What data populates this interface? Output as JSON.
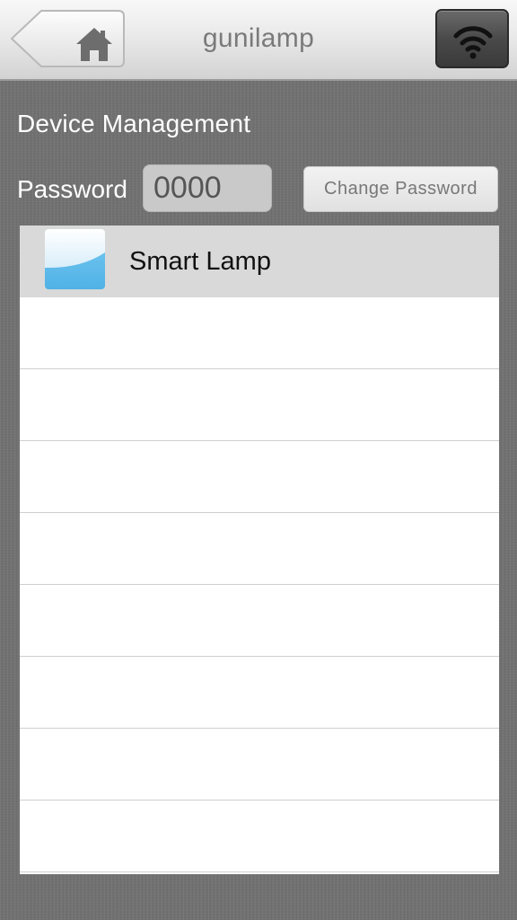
{
  "navbar": {
    "title": "gunilamp",
    "home_icon": "home-icon",
    "wifi_icon": "wifi-icon"
  },
  "content": {
    "section_title": "Device Management",
    "password_label": "Password",
    "password_value": "0000",
    "change_password_label": "Change Password"
  },
  "devices": [
    {
      "name": "Smart Lamp",
      "icon": "lamp-thumbnail",
      "selected": true
    },
    {
      "name": ""
    },
    {
      "name": ""
    },
    {
      "name": ""
    },
    {
      "name": ""
    },
    {
      "name": ""
    },
    {
      "name": ""
    },
    {
      "name": ""
    },
    {
      "name": ""
    }
  ],
  "colors": {
    "navbar_gradient_top": "#f8f8f8",
    "navbar_gradient_bottom": "#d2d2d2",
    "background": "#6f6f6f",
    "selected_row": "#d9d9d9",
    "thumb_blue": "#5ab8ea",
    "wifi_button": "#4a4a4a"
  }
}
